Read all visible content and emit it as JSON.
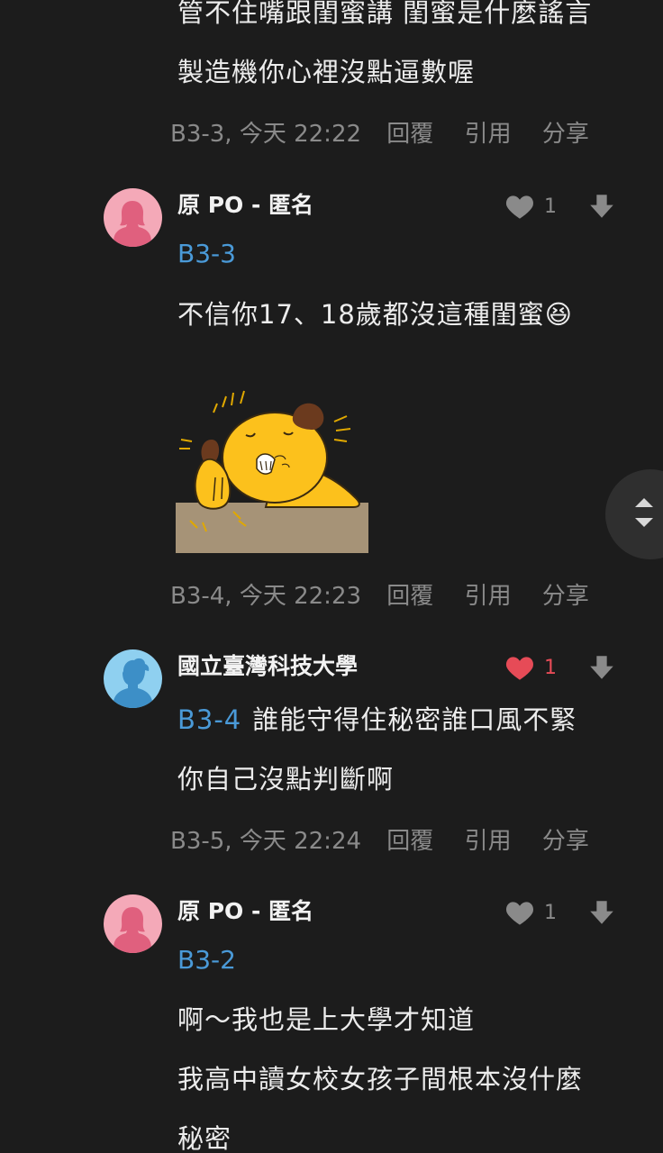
{
  "floor_b33": {
    "lines": [
      "管不住嘴跟閨蜜講 閨蜜是什麼謠言",
      "製造機你心裡沒點逼數喔"
    ],
    "floor": "B3-3, 今天 22:22",
    "reply": "回覆",
    "quote": "引用",
    "share": "分享"
  },
  "floor_b34": {
    "author": "原 PO - 匿名",
    "likes": "1",
    "reply_to": "B3-3",
    "lines": [
      "不信你17、18歲都沒這種閨蜜😆"
    ],
    "sticker": "yellow-dog-sticker",
    "floor": "B3-4, 今天 22:23",
    "reply": "回覆",
    "quote": "引用",
    "share": "分享"
  },
  "floor_b35": {
    "author": "國立臺灣科技大學",
    "likes": "1",
    "liked": true,
    "reply_to": "B3-4",
    "lines": [
      "誰能守得住秘密誰口風不緊",
      "你自己沒點判斷啊"
    ],
    "floor": "B3-5, 今天 22:24",
    "reply": "回覆",
    "quote": "引用",
    "share": "分享"
  },
  "floor_b36": {
    "author": "原 PO - 匿名",
    "likes": "1",
    "reply_to": "B3-2",
    "lines": [
      "啊～我也是上大學才知道",
      "我高中讀女校女孩子間根本沒什麼",
      "秘密"
    ]
  },
  "colors": {
    "background": "#1c1c1c",
    "link_blue": "#4a9ad8",
    "heart_liked": "#e64b57",
    "heart_default": "#8a8a8a",
    "avatar_female_bg": "#f4a9b8",
    "avatar_female_fg": "#e0607e",
    "avatar_male_bg": "#8fd0f0",
    "avatar_male_fg": "#3d8fc7"
  }
}
